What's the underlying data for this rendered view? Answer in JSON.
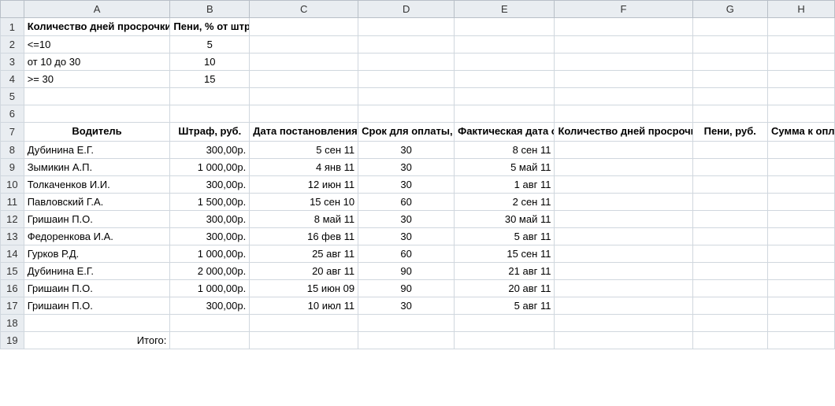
{
  "columns": [
    "A",
    "B",
    "C",
    "D",
    "E",
    "F",
    "G",
    "H"
  ],
  "row_labels": [
    "1",
    "2",
    "3",
    "4",
    "5",
    "6",
    "7",
    "8",
    "9",
    "10",
    "11",
    "12",
    "13",
    "14",
    "15",
    "16",
    "17",
    "18",
    "19"
  ],
  "top_table": {
    "header_a": "Количество дней просрочки платежа",
    "header_b": "Пени, % от штрафа",
    "rows": [
      {
        "range": "<=10",
        "percent": "5"
      },
      {
        "range": "от 10 до 30",
        "percent": "10"
      },
      {
        "range": ">= 30",
        "percent": "15"
      }
    ]
  },
  "main_table": {
    "headers": {
      "driver": "Водитель",
      "fine": "Штраф, руб.",
      "order_date": "Дата постановления",
      "pay_period": "Срок для оплаты, дней",
      "actual_date": "Фактическая дата оплаты",
      "overdue_days": "Количество дней просрочки платежа",
      "penalty": "Пени, руб.",
      "amount_due": "Сумма к оплате"
    },
    "rows": [
      {
        "driver": "Дубинина Е.Г.",
        "fine": "300,00р.",
        "order_date": "5 сен 11",
        "pay_period": "30",
        "actual_date": "8 сен 11"
      },
      {
        "driver": "Зымикин А.П.",
        "fine": "1 000,00р.",
        "order_date": "4 янв 11",
        "pay_period": "30",
        "actual_date": "5 май 11"
      },
      {
        "driver": "Толкаченков И.И.",
        "fine": "300,00р.",
        "order_date": "12 июн 11",
        "pay_period": "30",
        "actual_date": "1 авг 11"
      },
      {
        "driver": "Павловский Г.А.",
        "fine": "1 500,00р.",
        "order_date": "15 сен 10",
        "pay_period": "60",
        "actual_date": "2 сен 11"
      },
      {
        "driver": "Гришаин П.О.",
        "fine": "300,00р.",
        "order_date": "8 май 11",
        "pay_period": "30",
        "actual_date": "30 май 11"
      },
      {
        "driver": "Федоренкова И.А.",
        "fine": "300,00р.",
        "order_date": "16 фев 11",
        "pay_period": "30",
        "actual_date": "5 авг 11"
      },
      {
        "driver": "Гурков Р.Д.",
        "fine": "1 000,00р.",
        "order_date": "25 авг 11",
        "pay_period": "60",
        "actual_date": "15 сен 11"
      },
      {
        "driver": "Дубинина Е.Г.",
        "fine": "2 000,00р.",
        "order_date": "20 авг 11",
        "pay_period": "90",
        "actual_date": "21 авг 11"
      },
      {
        "driver": "Гришаин П.О.",
        "fine": "1 000,00р.",
        "order_date": "15 июн 09",
        "pay_period": "90",
        "actual_date": "20 авг 11"
      },
      {
        "driver": "Гришаин П.О.",
        "fine": "300,00р.",
        "order_date": "10 июл 11",
        "pay_period": "30",
        "actual_date": "5 авг 11"
      }
    ],
    "total_label": "Итого:"
  }
}
